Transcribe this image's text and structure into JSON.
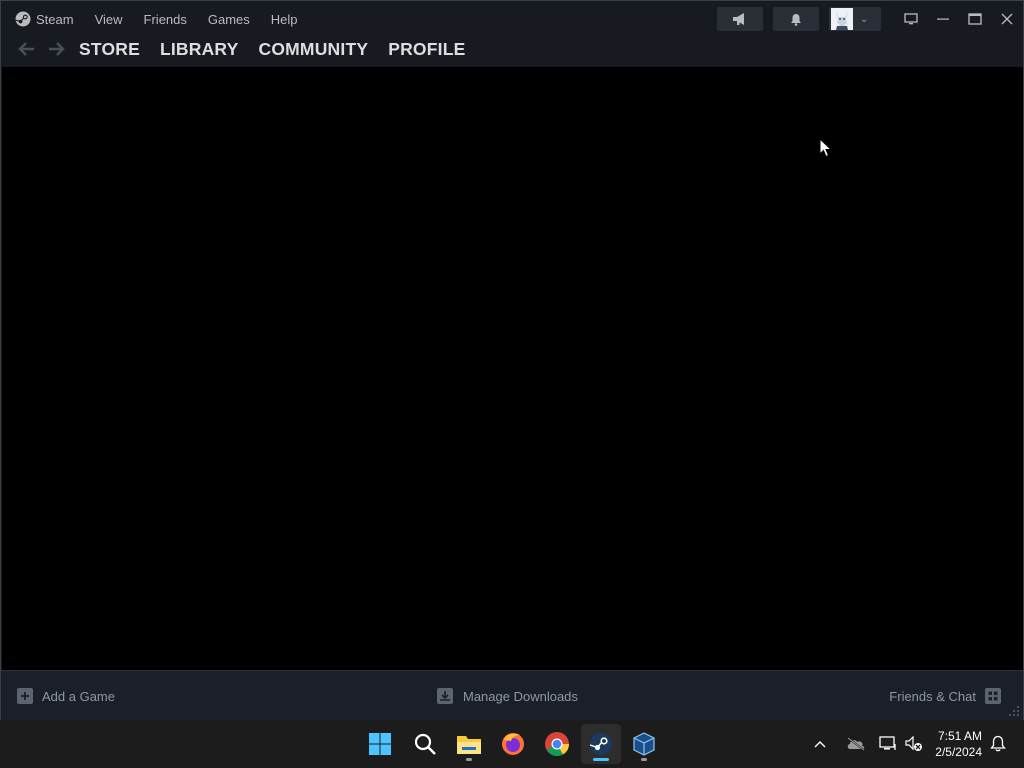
{
  "menu": {
    "items": [
      "Steam",
      "View",
      "Friends",
      "Games",
      "Help"
    ]
  },
  "nav": {
    "links": [
      "STORE",
      "LIBRARY",
      "COMMUNITY",
      "PROFILE"
    ]
  },
  "bottom": {
    "add_game": "Add a Game",
    "manage_downloads": "Manage Downloads",
    "friends_chat": "Friends & Chat"
  },
  "taskbar": {
    "apps": [
      "start-icon",
      "search-icon",
      "file-explorer-icon",
      "firefox-icon",
      "chrome-icon",
      "steam-icon",
      "virtualbox-icon"
    ],
    "time": "7:51 AM",
    "date": "2/5/2024"
  },
  "colors": {
    "window_bg": "#171a21",
    "content_bg": "#000000",
    "accent": "#4cc2ff"
  }
}
